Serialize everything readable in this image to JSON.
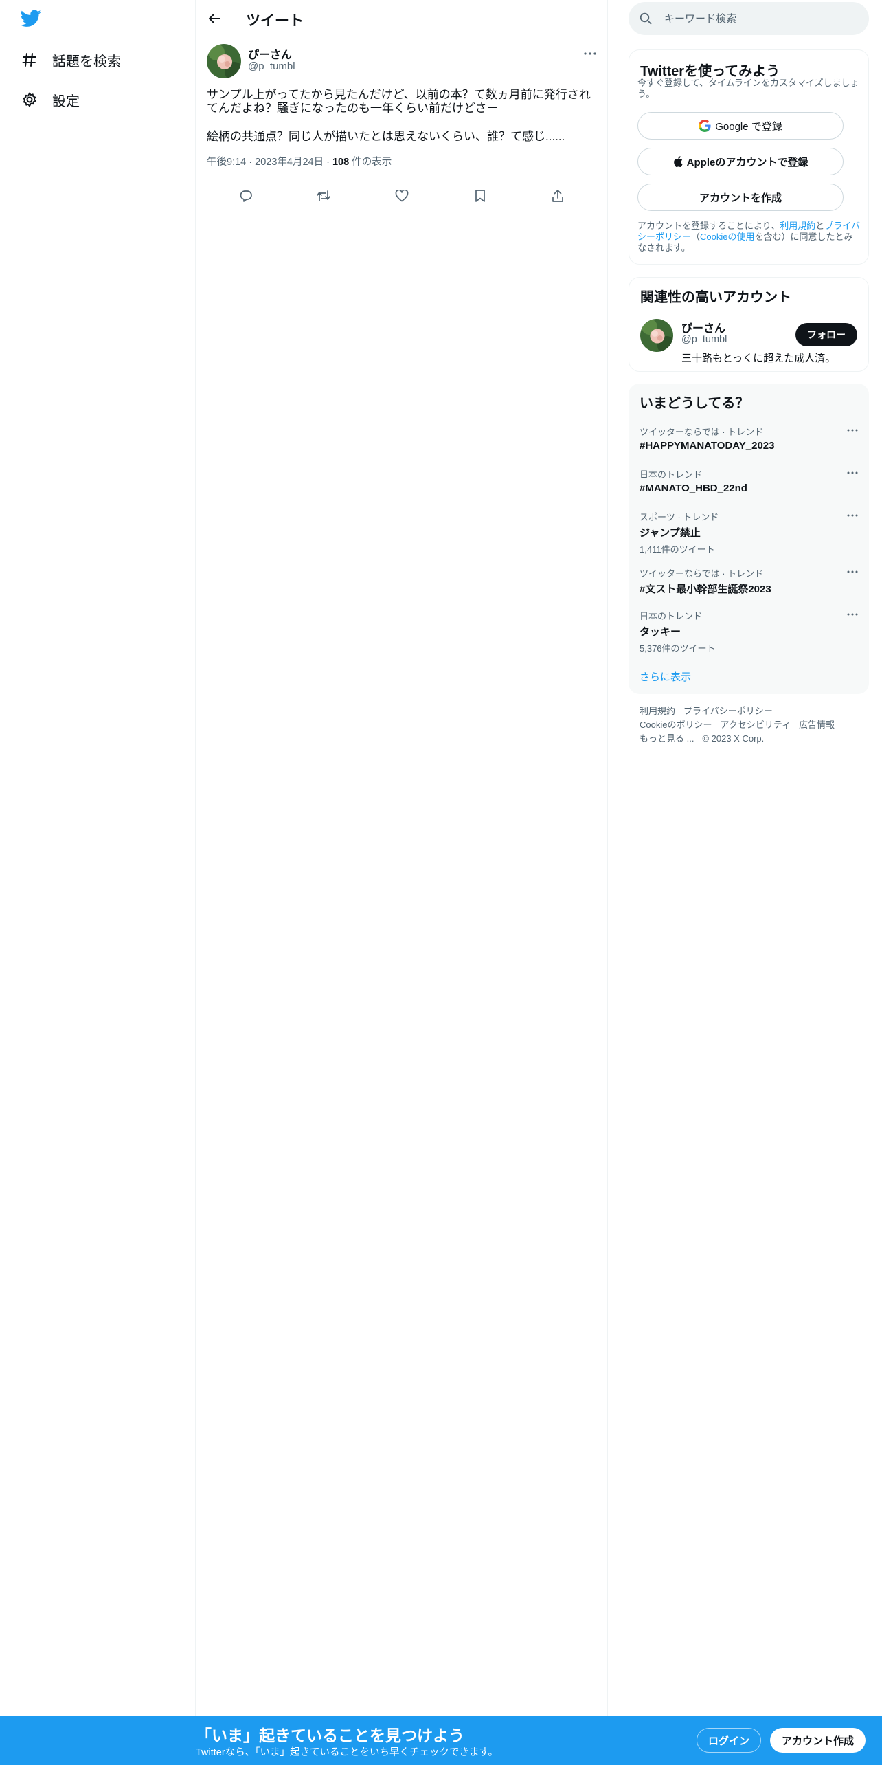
{
  "nav": {
    "logo_icon": "twitter-bird-icon",
    "brand_color": "#1d9bf0",
    "items": [
      {
        "label": "話題を検索",
        "icon": "hashtag-icon"
      },
      {
        "label": "設定",
        "icon": "gear-icon"
      }
    ]
  },
  "main": {
    "title": "ツイート",
    "tweet": {
      "name": "ぴーさん",
      "handle": "@p_tumbl",
      "text": [
        "サンプル上がってたから見たんだけど、以前の本？て数ヵ月前に発行されてんだよね？騒ぎになったのも一年くらい前だけどさー",
        "絵柄の共通点？同じ人が描いたとは思えないくらい、誰？て感じ......"
      ],
      "time": "午後9:14",
      "date": "2023年4月24日",
      "views": "108",
      "views_label": "件の表示"
    }
  },
  "right": {
    "search_placeholder": "キーワード検索",
    "signup": {
      "title": "Twitterを使ってみよう",
      "subtitle": "今すぐ登録して、タイムラインをカスタマイズしましょう。",
      "google": "Google で登録",
      "apple": "Appleのアカウントで登録",
      "create": "アカウントを作成",
      "legal_1": "アカウントを登録することにより、",
      "legal_tos": "利用規約",
      "legal_and": "と",
      "legal_privacy": "プライバシーポリシー",
      "legal_2": "（",
      "legal_cookie": "Cookieの使用",
      "legal_3": "を含む）に同意したとみなされます。"
    },
    "related": {
      "title": "関連性の高いアカウント",
      "name": "ぴーさん",
      "handle": "@p_tumbl",
      "bio": "三十路もとっくに超えた成人済。",
      "follow": "フォロー"
    },
    "trends": {
      "title": "いまどうしてる？",
      "items": [
        {
          "context": "ツイッターならでは · トレンド",
          "name": "#HAPPYMANATODAY_2023",
          "count": ""
        },
        {
          "context": "日本のトレンド",
          "name": "#MANATO_HBD_22nd",
          "count": ""
        },
        {
          "context": "スポーツ · トレンド",
          "name": "ジャンプ禁止",
          "count": "1,411件のツイート"
        },
        {
          "context": "ツイッターならでは · トレンド",
          "name": "#文スト最小幹部生誕祭2023",
          "count": ""
        },
        {
          "context": "日本のトレンド",
          "name": "タッキー",
          "count": "5,376件のツイート"
        }
      ],
      "show_more": "さらに表示"
    },
    "footer": {
      "tos": "利用規約",
      "privacy": "プライバシーポリシー",
      "cookie": "Cookieのポリシー",
      "accessibility": "アクセシビリティ",
      "ads": "広告情報",
      "more": "もっと見る ...",
      "copyright": "© 2023 X Corp."
    }
  },
  "bottom": {
    "title": "「いま」起きていることを見つけよう",
    "subtitle": "Twitterなら、「いま」起きていることをいち早くチェックできます。",
    "login": "ログイン",
    "signup": "アカウント作成"
  }
}
